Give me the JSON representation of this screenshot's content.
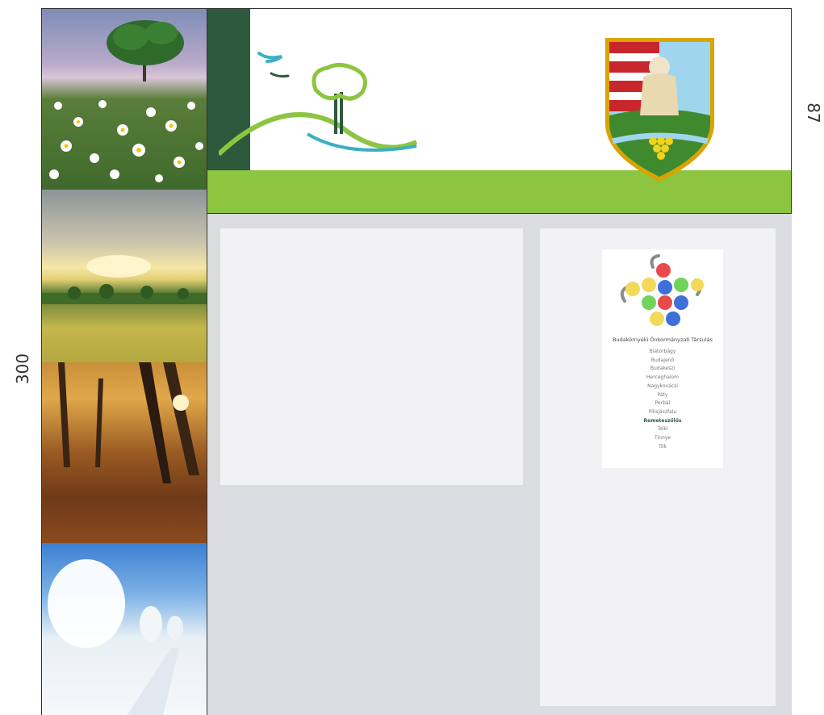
{
  "dimensions": {
    "height_label": "300",
    "width_label": "87"
  },
  "photos": [
    {
      "name": "daisy-meadow-photo"
    },
    {
      "name": "wheat-field-sunset-photo"
    },
    {
      "name": "autumn-forest-photo"
    },
    {
      "name": "winter-snow-photo"
    }
  ],
  "header": {
    "logo_icon": "tree-hill-birds-logo",
    "crest_icon": "municipal-coat-of-arms"
  },
  "association": {
    "logo_icon": "grape-cluster-logo",
    "title": "Budakörnyéki Önkormányzati Társulás",
    "towns": [
      "Biatorbágy",
      "Budajenő",
      "Budakeszi",
      "Herceghalom",
      "Nagykovácsi",
      "Páty",
      "Perbál",
      "Pilisjászfalu",
      "Remeteszőlős",
      "Telki",
      "Tinnye",
      "Tök"
    ],
    "active_town": "Remeteszőlős"
  },
  "colors": {
    "dark_green": "#2d5a3c",
    "light_green": "#8cc540",
    "panel_bg": "#f2f2f4",
    "content_bg": "#dcdde0"
  }
}
